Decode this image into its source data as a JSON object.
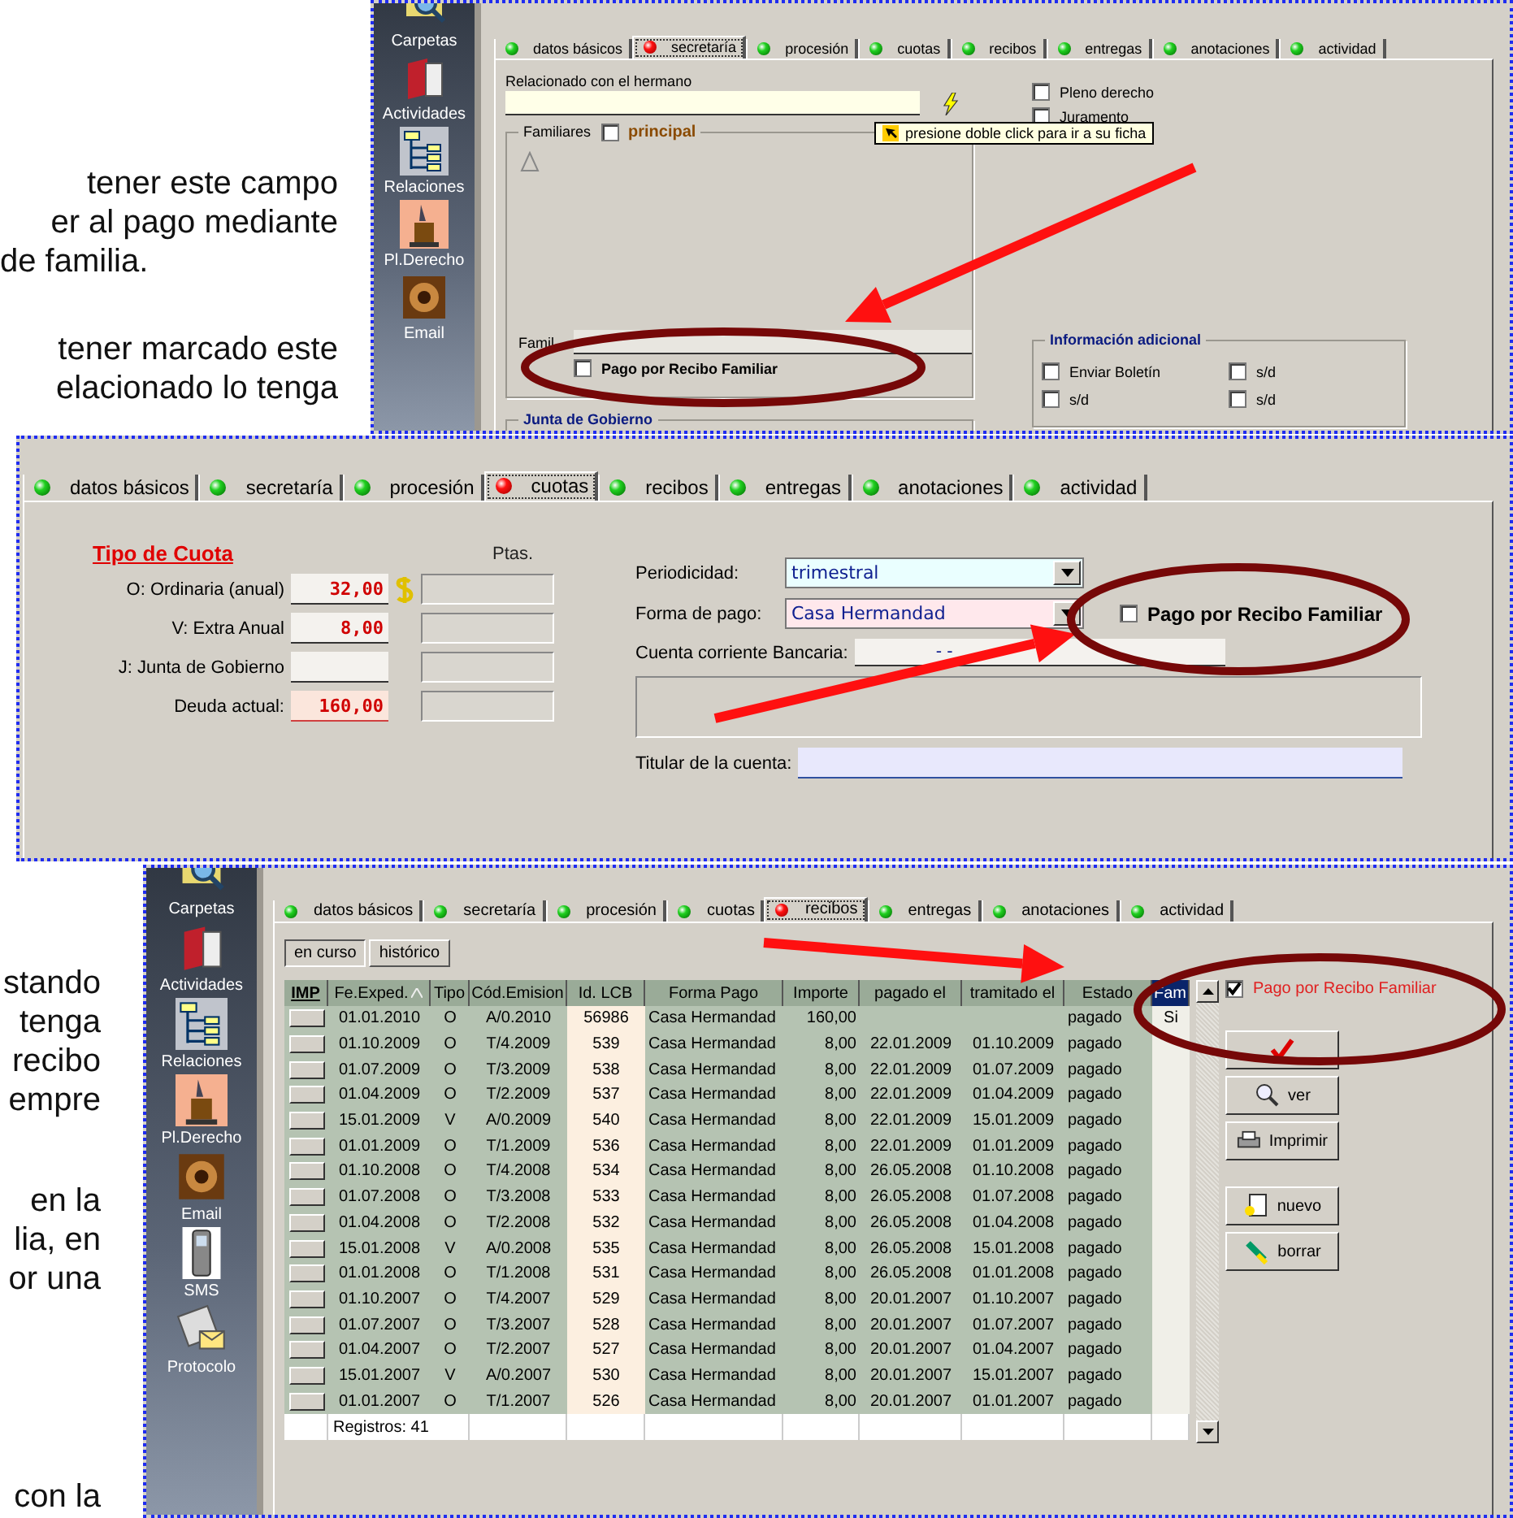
{
  "document_text": [
    {
      "lines": [
        "tener este campo",
        "er al pago mediante",
        "de familia."
      ]
    },
    {
      "lines": [
        "tener marcado este",
        "elacionado lo tenga"
      ]
    },
    {
      "lines": [
        "stando",
        "tenga",
        "recibo",
        "empre"
      ]
    },
    {
      "lines": [
        "en la",
        "lia, en",
        "or una"
      ]
    },
    {
      "lines": [
        "con la"
      ]
    }
  ],
  "screenshot_secretaria": {
    "sidebar": [
      {
        "label": "Carpetas",
        "kind": "folders"
      },
      {
        "label": "Actividades",
        "kind": "book"
      },
      {
        "label": "Relaciones",
        "kind": "tree"
      },
      {
        "label": "Pl.Derecho",
        "kind": "lectern"
      },
      {
        "label": "Email",
        "kind": "email"
      }
    ],
    "tabs": [
      {
        "label": "datos básicos",
        "selected": false
      },
      {
        "label": "secretaría",
        "selected": true
      },
      {
        "label": "procesión",
        "selected": false
      },
      {
        "label": "cuotas",
        "selected": false
      },
      {
        "label": "recibos",
        "selected": false
      },
      {
        "label": "entregas",
        "selected": false
      },
      {
        "label": "anotaciones",
        "selected": false
      },
      {
        "label": "actividad",
        "selected": false
      }
    ],
    "related_label": "Relacionado con el hermano",
    "right_checks": [
      {
        "label": "Pleno derecho",
        "checked": false
      },
      {
        "label": "Juramento",
        "checked": false
      }
    ],
    "tooltip": "presione doble click para ir a su ficha",
    "familiares": {
      "title": "Familiares",
      "principal": {
        "label": "principal",
        "checked": false
      },
      "field_label": "Famil",
      "pago_familiar": {
        "label": "Pago por Recibo Familiar",
        "checked": false
      }
    },
    "junta_title": "Junta de Gobierno",
    "info": {
      "title": "Información adicional",
      "checks": [
        {
          "label": "Enviar Boletín",
          "checked": false
        },
        {
          "label": "s/d",
          "checked": false
        },
        {
          "label": "s/d",
          "checked": false
        },
        {
          "label": "s/d",
          "checked": false
        }
      ]
    }
  },
  "screenshot_cuotas": {
    "tabs": [
      {
        "label": "datos básicos",
        "selected": false
      },
      {
        "label": "secretaría",
        "selected": false
      },
      {
        "label": "procesión",
        "selected": false
      },
      {
        "label": "cuotas",
        "selected": true
      },
      {
        "label": "recibos",
        "selected": false
      },
      {
        "label": "entregas",
        "selected": false
      },
      {
        "label": "anotaciones",
        "selected": false
      },
      {
        "label": "actividad",
        "selected": false
      }
    ],
    "fee_title": "Tipo de Cuota",
    "ptas_header": "Ptas.",
    "fees": [
      {
        "label": "O: Ordinaria (anual)",
        "value": "32,00",
        "kind": "currency"
      },
      {
        "label": "V: Extra Anual",
        "value": "8,00",
        "kind": "plain"
      },
      {
        "label": "J: Junta de Gobierno",
        "kind": "plain"
      },
      {
        "label": "Deuda actual:",
        "value": "160,00",
        "kind": "debt"
      }
    ],
    "periodicity": {
      "label": "Periodicidad:",
      "value": "trimestral"
    },
    "payment_method": {
      "label": "Forma de pago:",
      "value": "Casa Hermandad"
    },
    "pago_familiar": {
      "label": "Pago por Recibo Familiar",
      "checked": false
    },
    "bank_account": {
      "label": "Cuenta corriente Bancaria:",
      "value": "-  -"
    },
    "account_holder": {
      "label": "Titular de la cuenta:"
    }
  },
  "screenshot_recibos": {
    "sidebar": [
      {
        "label": "Carpetas",
        "kind": "folders"
      },
      {
        "label": "Actividades",
        "kind": "book"
      },
      {
        "label": "Relaciones",
        "kind": "tree"
      },
      {
        "label": "Pl.Derecho",
        "kind": "lectern"
      },
      {
        "label": "Email",
        "kind": "email"
      },
      {
        "label": "SMS",
        "kind": "phone"
      },
      {
        "label": "Protocolo",
        "kind": "mail"
      }
    ],
    "tabs": [
      {
        "label": "datos básicos",
        "selected": false
      },
      {
        "label": "secretaría",
        "selected": false
      },
      {
        "label": "procesión",
        "selected": false
      },
      {
        "label": "cuotas",
        "selected": false
      },
      {
        "label": "recibos",
        "selected": true
      },
      {
        "label": "entregas",
        "selected": false
      },
      {
        "label": "anotaciones",
        "selected": false
      },
      {
        "label": "actividad",
        "selected": false
      }
    ],
    "subtabs": [
      {
        "label": "en curso",
        "selected": true
      },
      {
        "label": "histórico",
        "selected": false
      }
    ],
    "columns": [
      {
        "label": "IMP",
        "sorted": false,
        "selected": false
      },
      {
        "label": "Fe.Exped.",
        "sorted": true,
        "selected": false
      },
      {
        "label": "Tipo",
        "sorted": false,
        "selected": false
      },
      {
        "label": "Cód.Emision",
        "sorted": false,
        "selected": false
      },
      {
        "label": "Id. LCB",
        "sorted": false,
        "selected": false
      },
      {
        "label": "Forma Pago",
        "sorted": false,
        "selected": false
      },
      {
        "label": "Importe",
        "sorted": false,
        "selected": false
      },
      {
        "label": "pagado el",
        "sorted": false,
        "selected": false
      },
      {
        "label": "tramitado el",
        "sorted": false,
        "selected": false
      },
      {
        "label": "Estado",
        "sorted": false,
        "selected": false
      },
      {
        "label": "Fam",
        "sorted": false,
        "selected": true
      }
    ],
    "rows": [
      {
        "date": "01.01.2010",
        "type": "O",
        "code": "A/0.2010",
        "id": "56986",
        "payment": "Casa Hermandad",
        "amount": "160,00",
        "status": "pagado",
        "fam": "Si"
      },
      {
        "date": "01.10.2009",
        "type": "O",
        "code": "T/4.2009",
        "id": "539",
        "payment": "Casa Hermandad",
        "amount": "8,00",
        "paid": "22.01.2009",
        "processed": "01.10.2009",
        "status": "pagado"
      },
      {
        "date": "01.07.2009",
        "type": "O",
        "code": "T/3.2009",
        "id": "538",
        "payment": "Casa Hermandad",
        "amount": "8,00",
        "paid": "22.01.2009",
        "processed": "01.07.2009",
        "status": "pagado"
      },
      {
        "date": "01.04.2009",
        "type": "O",
        "code": "T/2.2009",
        "id": "537",
        "payment": "Casa Hermandad",
        "amount": "8,00",
        "paid": "22.01.2009",
        "processed": "01.04.2009",
        "status": "pagado"
      },
      {
        "date": "15.01.2009",
        "type": "V",
        "code": "A/0.2009",
        "id": "540",
        "payment": "Casa Hermandad",
        "amount": "8,00",
        "paid": "22.01.2009",
        "processed": "15.01.2009",
        "status": "pagado"
      },
      {
        "date": "01.01.2009",
        "type": "O",
        "code": "T/1.2009",
        "id": "536",
        "payment": "Casa Hermandad",
        "amount": "8,00",
        "paid": "22.01.2009",
        "processed": "01.01.2009",
        "status": "pagado"
      },
      {
        "date": "01.10.2008",
        "type": "O",
        "code": "T/4.2008",
        "id": "534",
        "payment": "Casa Hermandad",
        "amount": "8,00",
        "paid": "26.05.2008",
        "processed": "01.10.2008",
        "status": "pagado"
      },
      {
        "date": "01.07.2008",
        "type": "O",
        "code": "T/3.2008",
        "id": "533",
        "payment": "Casa Hermandad",
        "amount": "8,00",
        "paid": "26.05.2008",
        "processed": "01.07.2008",
        "status": "pagado"
      },
      {
        "date": "01.04.2008",
        "type": "O",
        "code": "T/2.2008",
        "id": "532",
        "payment": "Casa Hermandad",
        "amount": "8,00",
        "paid": "26.05.2008",
        "processed": "01.04.2008",
        "status": "pagado"
      },
      {
        "date": "15.01.2008",
        "type": "V",
        "code": "A/0.2008",
        "id": "535",
        "payment": "Casa Hermandad",
        "amount": "8,00",
        "paid": "26.05.2008",
        "processed": "15.01.2008",
        "status": "pagado"
      },
      {
        "date": "01.01.2008",
        "type": "O",
        "code": "T/1.2008",
        "id": "531",
        "payment": "Casa Hermandad",
        "amount": "8,00",
        "paid": "26.05.2008",
        "processed": "01.01.2008",
        "status": "pagado"
      },
      {
        "date": "01.10.2007",
        "type": "O",
        "code": "T/4.2007",
        "id": "529",
        "payment": "Casa Hermandad",
        "amount": "8,00",
        "paid": "20.01.2007",
        "processed": "01.10.2007",
        "status": "pagado"
      },
      {
        "date": "01.07.2007",
        "type": "O",
        "code": "T/3.2007",
        "id": "528",
        "payment": "Casa Hermandad",
        "amount": "8,00",
        "paid": "20.01.2007",
        "processed": "01.07.2007",
        "status": "pagado"
      },
      {
        "date": "01.04.2007",
        "type": "O",
        "code": "T/2.2007",
        "id": "527",
        "payment": "Casa Hermandad",
        "amount": "8,00",
        "paid": "20.01.2007",
        "processed": "01.04.2007",
        "status": "pagado"
      },
      {
        "date": "15.01.2007",
        "type": "V",
        "code": "A/0.2007",
        "id": "530",
        "payment": "Casa Hermandad",
        "amount": "8,00",
        "paid": "20.01.2007",
        "processed": "15.01.2007",
        "status": "pagado"
      },
      {
        "date": "01.01.2007",
        "type": "O",
        "code": "T/1.2007",
        "id": "526",
        "payment": "Casa Hermandad",
        "amount": "8,00",
        "paid": "20.01.2007",
        "processed": "01.01.2007",
        "status": "pagado"
      }
    ],
    "footer": "Registros: 41",
    "family_check": {
      "label": "Pago por Recibo Familiar",
      "checked": true
    },
    "buttons": [
      {
        "kind": "update"
      },
      {
        "label": "ver",
        "kind": "view"
      },
      {
        "label": "Imprimir",
        "kind": "print"
      },
      {
        "label": "nuevo",
        "kind": "new"
      },
      {
        "label": "borrar",
        "kind": "delete"
      }
    ]
  }
}
